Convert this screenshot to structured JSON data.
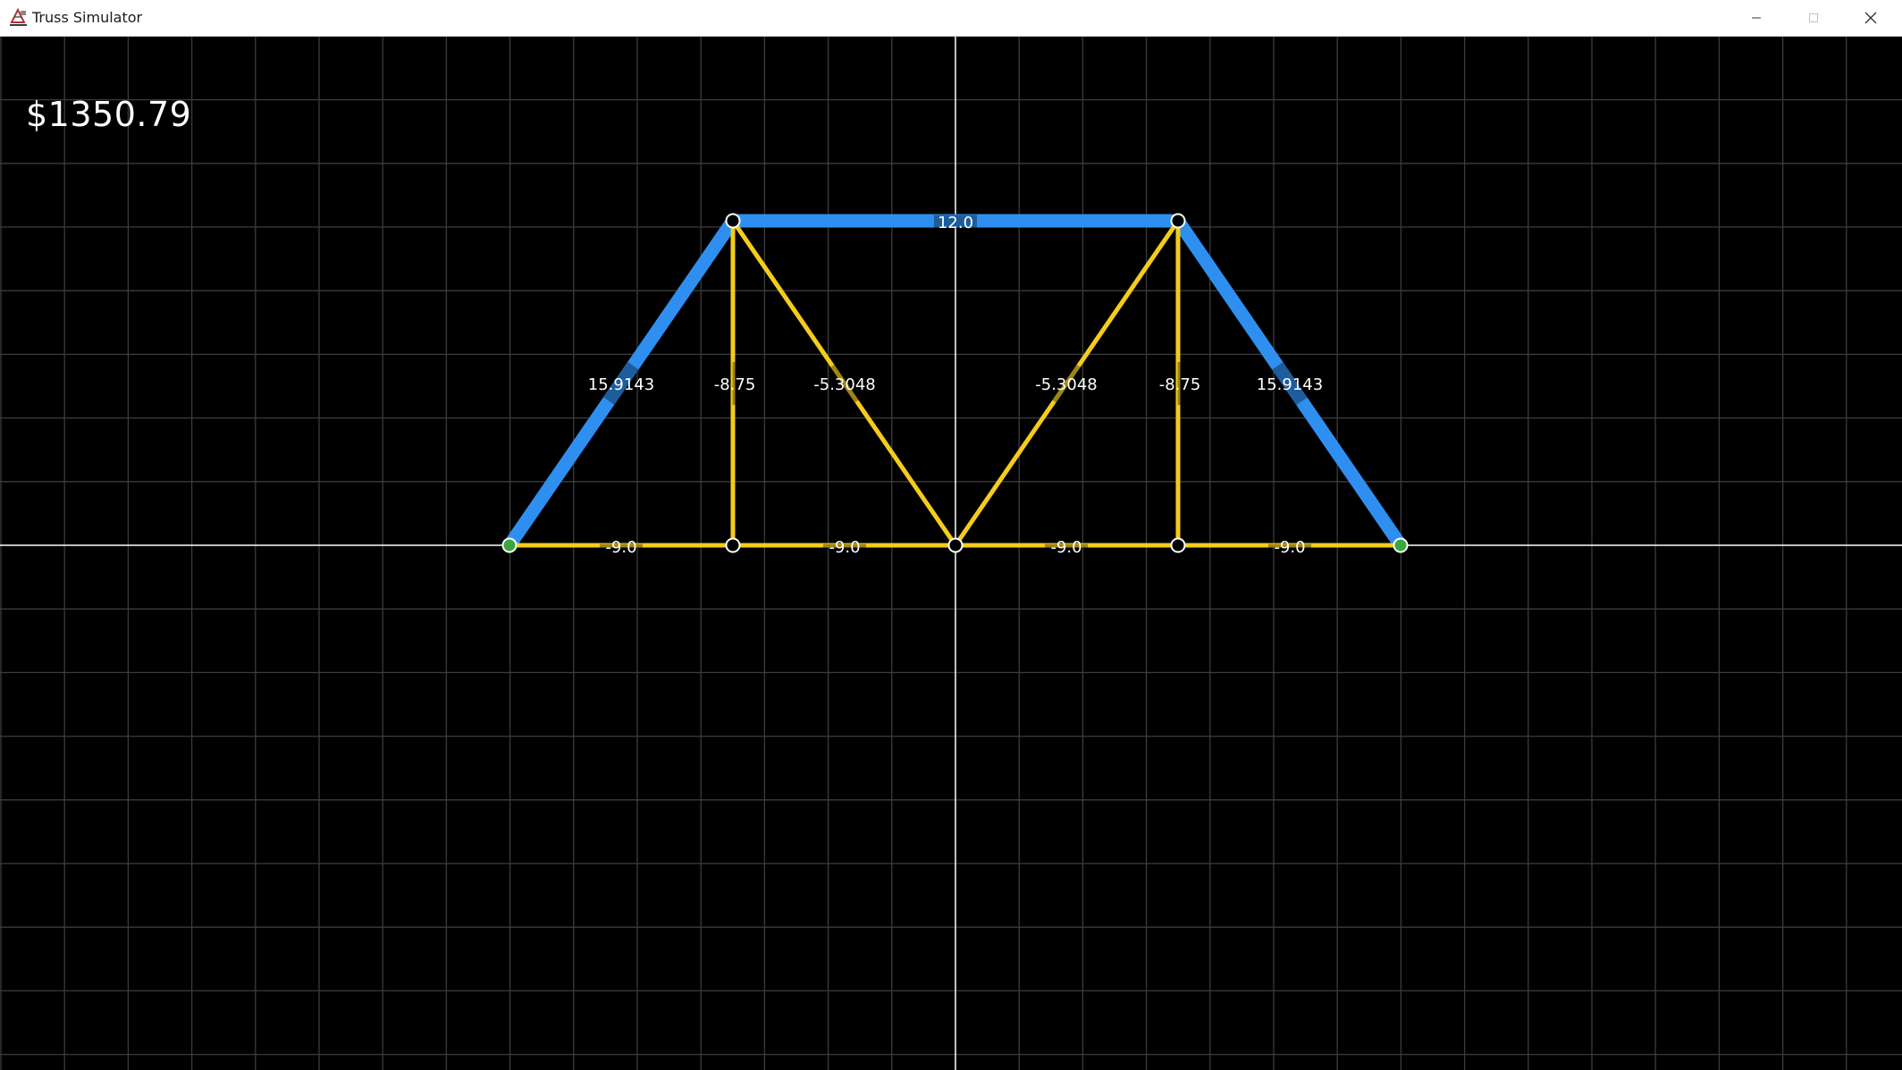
{
  "window": {
    "title": "Truss Simulator",
    "app_icon": "truss-app-icon",
    "controls": [
      "minimize-icon",
      "maximize-icon",
      "close-icon"
    ]
  },
  "hud": {
    "cost": "$1350.79"
  },
  "colors": {
    "background": "#000000",
    "grid": "#3c3c3c",
    "axes": "#ffffff",
    "compression_member": "#2f8ff0",
    "tension_member": "#f4cc1a",
    "pin_joint_fill": "#000000",
    "support_joint_fill": "#3aa640",
    "label_text": "#ffffff"
  },
  "truss": {
    "joints": [
      {
        "id": "A",
        "type": "support"
      },
      {
        "id": "B",
        "type": "free"
      },
      {
        "id": "C",
        "type": "free"
      },
      {
        "id": "D",
        "type": "free"
      },
      {
        "id": "E",
        "type": "support"
      },
      {
        "id": "F",
        "type": "free"
      },
      {
        "id": "G",
        "type": "free"
      }
    ],
    "members": [
      {
        "from": "A",
        "to": "F",
        "force": "15.9143",
        "kind": "compression"
      },
      {
        "from": "F",
        "to": "G",
        "force": "12.0",
        "kind": "compression"
      },
      {
        "from": "G",
        "to": "E",
        "force": "15.9143",
        "kind": "compression"
      },
      {
        "from": "F",
        "to": "B",
        "force": "-8.75",
        "kind": "tension"
      },
      {
        "from": "F",
        "to": "C",
        "force": "-5.3048",
        "kind": "tension"
      },
      {
        "from": "C",
        "to": "G",
        "force": "-5.3048",
        "kind": "tension"
      },
      {
        "from": "G",
        "to": "D",
        "force": "-8.75",
        "kind": "tension"
      },
      {
        "from": "A",
        "to": "B",
        "force": "-9.0",
        "kind": "tension"
      },
      {
        "from": "B",
        "to": "C",
        "force": "-9.0",
        "kind": "tension"
      },
      {
        "from": "C",
        "to": "D",
        "force": "-9.0",
        "kind": "tension"
      },
      {
        "from": "D",
        "to": "E",
        "force": "-9.0",
        "kind": "tension"
      }
    ]
  }
}
